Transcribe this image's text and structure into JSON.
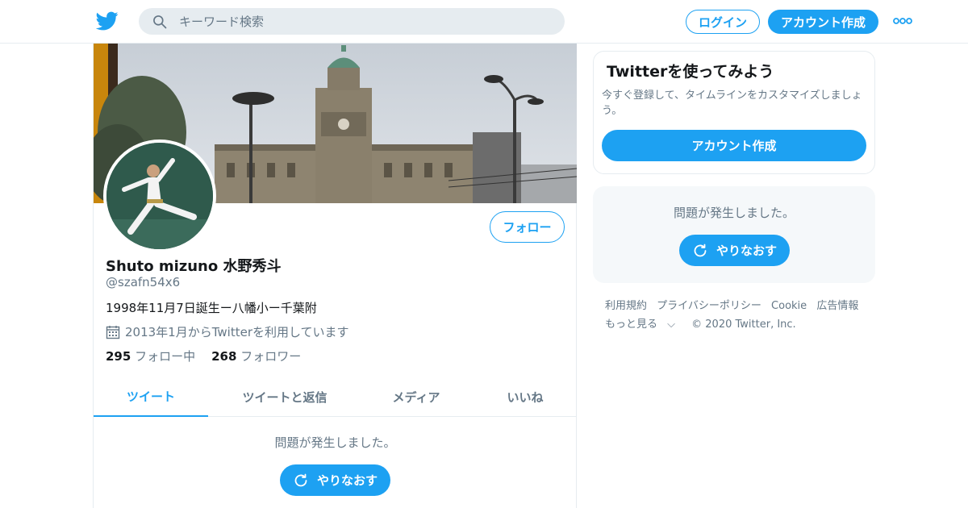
{
  "header": {
    "search_placeholder": "キーワード検索",
    "login_label": "ログイン",
    "signup_label": "アカウント作成"
  },
  "profile": {
    "follow_label": "フォロー",
    "display_name": "Shuto mizuno 水野秀斗",
    "handle": "@szafn54x6",
    "bio": "1998年11月7日誕生ー八幡小ー千葉附",
    "joined": "2013年1月からTwitterを利用しています",
    "following_count": "295",
    "following_label": "フォロー中",
    "followers_count": "268",
    "followers_label": "フォロワー"
  },
  "tabs": [
    {
      "label": "ツイート",
      "active": true
    },
    {
      "label": "ツイートと返信",
      "active": false
    },
    {
      "label": "メディア",
      "active": false
    },
    {
      "label": "いいね",
      "active": false
    }
  ],
  "main_error": {
    "message": "問題が発生しました。",
    "retry_label": "やりなおす"
  },
  "sidebar": {
    "signup_card": {
      "title": "Twitterを使ってみよう",
      "text": "今すぐ登録して、タイムラインをカスタマイズしましょう。",
      "button_label": "アカウント作成"
    },
    "error": {
      "message": "問題が発生しました。",
      "retry_label": "やりなおす"
    },
    "footer": {
      "links": [
        "利用規約",
        "プライバシーポリシー",
        "Cookie",
        "広告情報"
      ],
      "more_label": "もっと見る",
      "copyright": "© 2020 Twitter, Inc."
    }
  },
  "colors": {
    "accent": "#1da1f2",
    "text_primary": "#14171a",
    "text_secondary": "#657786",
    "border": "#e6ecf0"
  },
  "icons": [
    "twitter-bird-icon",
    "search-icon",
    "more-dots-icon",
    "calendar-icon",
    "refresh-icon"
  ]
}
